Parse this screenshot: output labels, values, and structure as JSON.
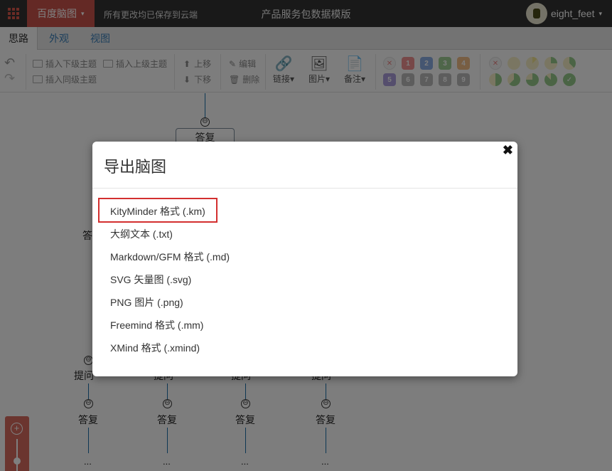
{
  "topbar": {
    "menu_icon": "grid-icon",
    "brand_label": "百度脑图",
    "brand_caret": "▾",
    "save_status": "所有更改均已保存到云端",
    "doc_title": "产品服务包数据模版",
    "username": "eight_feet",
    "user_caret": "▾"
  },
  "tabs": [
    {
      "label": "思路",
      "active": true
    },
    {
      "label": "外观",
      "active": false
    },
    {
      "label": "视图",
      "active": false
    }
  ],
  "toolbar": {
    "undo_icon": "undo-icon",
    "redo_icon": "redo-icon",
    "insert_child": "插入下级主题",
    "insert_parent": "插入上级主题",
    "insert_sibling": "插入同级主题",
    "move_up": "上移",
    "move_down": "下移",
    "edit": "编辑",
    "delete": "删除",
    "link": "链接",
    "image": "图片",
    "note": "备注",
    "dropdown_caret": "▾",
    "priorities": [
      "1",
      "2",
      "3",
      "4",
      "5",
      "6",
      "7",
      "8",
      "9"
    ],
    "priority_colors": [
      "#e73c3c",
      "#2f6fcf",
      "#53a840",
      "#e88a2a",
      "#6a4fc1",
      "#888888",
      "#888888",
      "#888888",
      "#888888"
    ],
    "progress_colors": [
      "#e8d24a",
      "#53a840"
    ]
  },
  "canvas": {
    "root_node": "答复",
    "side_node": "答",
    "branches": [
      {
        "top": "提问",
        "answer": "答复",
        "more": "..."
      },
      {
        "top": "提问",
        "answer": "答复",
        "more": "..."
      },
      {
        "top": "提问",
        "answer": "答复",
        "more": "..."
      },
      {
        "top": "提问",
        "answer": "答复",
        "more": "..."
      }
    ],
    "collapse_symbol": "⊖",
    "zoom_in_symbol": "+"
  },
  "modal": {
    "title": "导出脑图",
    "close_symbol": "✖",
    "formats": [
      "KityMinder 格式 (.km)",
      "大纲文本 (.txt)",
      "Markdown/GFM 格式 (.md)",
      "SVG 矢量图 (.svg)",
      "PNG 图片 (.png)",
      "Freemind 格式 (.mm)",
      "XMind 格式 (.xmind)"
    ],
    "highlighted_format": "KityMinder 格式 (.km)",
    "highlight_color": "#d32f2f"
  }
}
